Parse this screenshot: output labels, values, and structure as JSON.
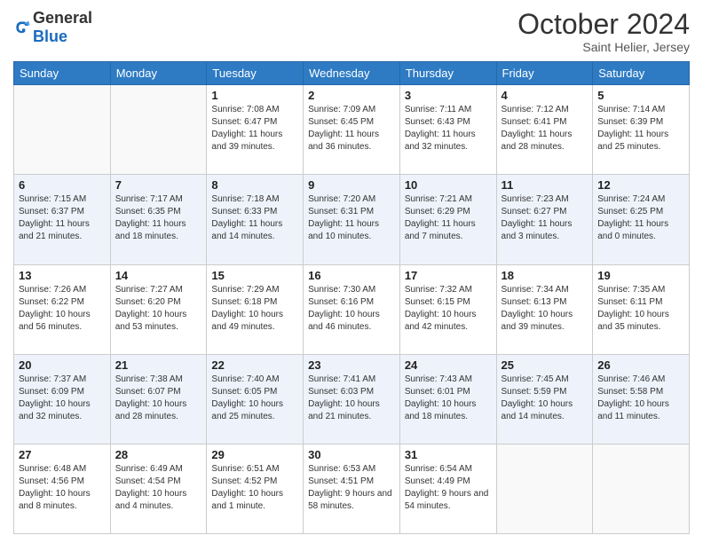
{
  "header": {
    "logo_general": "General",
    "logo_blue": "Blue",
    "month_title": "October 2024",
    "subtitle": "Saint Helier, Jersey"
  },
  "days_of_week": [
    "Sunday",
    "Monday",
    "Tuesday",
    "Wednesday",
    "Thursday",
    "Friday",
    "Saturday"
  ],
  "weeks": [
    [
      {
        "day": "",
        "info": ""
      },
      {
        "day": "",
        "info": ""
      },
      {
        "day": "1",
        "info": "Sunrise: 7:08 AM\nSunset: 6:47 PM\nDaylight: 11 hours and 39 minutes."
      },
      {
        "day": "2",
        "info": "Sunrise: 7:09 AM\nSunset: 6:45 PM\nDaylight: 11 hours and 36 minutes."
      },
      {
        "day": "3",
        "info": "Sunrise: 7:11 AM\nSunset: 6:43 PM\nDaylight: 11 hours and 32 minutes."
      },
      {
        "day": "4",
        "info": "Sunrise: 7:12 AM\nSunset: 6:41 PM\nDaylight: 11 hours and 28 minutes."
      },
      {
        "day": "5",
        "info": "Sunrise: 7:14 AM\nSunset: 6:39 PM\nDaylight: 11 hours and 25 minutes."
      }
    ],
    [
      {
        "day": "6",
        "info": "Sunrise: 7:15 AM\nSunset: 6:37 PM\nDaylight: 11 hours and 21 minutes."
      },
      {
        "day": "7",
        "info": "Sunrise: 7:17 AM\nSunset: 6:35 PM\nDaylight: 11 hours and 18 minutes."
      },
      {
        "day": "8",
        "info": "Sunrise: 7:18 AM\nSunset: 6:33 PM\nDaylight: 11 hours and 14 minutes."
      },
      {
        "day": "9",
        "info": "Sunrise: 7:20 AM\nSunset: 6:31 PM\nDaylight: 11 hours and 10 minutes."
      },
      {
        "day": "10",
        "info": "Sunrise: 7:21 AM\nSunset: 6:29 PM\nDaylight: 11 hours and 7 minutes."
      },
      {
        "day": "11",
        "info": "Sunrise: 7:23 AM\nSunset: 6:27 PM\nDaylight: 11 hours and 3 minutes."
      },
      {
        "day": "12",
        "info": "Sunrise: 7:24 AM\nSunset: 6:25 PM\nDaylight: 11 hours and 0 minutes."
      }
    ],
    [
      {
        "day": "13",
        "info": "Sunrise: 7:26 AM\nSunset: 6:22 PM\nDaylight: 10 hours and 56 minutes."
      },
      {
        "day": "14",
        "info": "Sunrise: 7:27 AM\nSunset: 6:20 PM\nDaylight: 10 hours and 53 minutes."
      },
      {
        "day": "15",
        "info": "Sunrise: 7:29 AM\nSunset: 6:18 PM\nDaylight: 10 hours and 49 minutes."
      },
      {
        "day": "16",
        "info": "Sunrise: 7:30 AM\nSunset: 6:16 PM\nDaylight: 10 hours and 46 minutes."
      },
      {
        "day": "17",
        "info": "Sunrise: 7:32 AM\nSunset: 6:15 PM\nDaylight: 10 hours and 42 minutes."
      },
      {
        "day": "18",
        "info": "Sunrise: 7:34 AM\nSunset: 6:13 PM\nDaylight: 10 hours and 39 minutes."
      },
      {
        "day": "19",
        "info": "Sunrise: 7:35 AM\nSunset: 6:11 PM\nDaylight: 10 hours and 35 minutes."
      }
    ],
    [
      {
        "day": "20",
        "info": "Sunrise: 7:37 AM\nSunset: 6:09 PM\nDaylight: 10 hours and 32 minutes."
      },
      {
        "day": "21",
        "info": "Sunrise: 7:38 AM\nSunset: 6:07 PM\nDaylight: 10 hours and 28 minutes."
      },
      {
        "day": "22",
        "info": "Sunrise: 7:40 AM\nSunset: 6:05 PM\nDaylight: 10 hours and 25 minutes."
      },
      {
        "day": "23",
        "info": "Sunrise: 7:41 AM\nSunset: 6:03 PM\nDaylight: 10 hours and 21 minutes."
      },
      {
        "day": "24",
        "info": "Sunrise: 7:43 AM\nSunset: 6:01 PM\nDaylight: 10 hours and 18 minutes."
      },
      {
        "day": "25",
        "info": "Sunrise: 7:45 AM\nSunset: 5:59 PM\nDaylight: 10 hours and 14 minutes."
      },
      {
        "day": "26",
        "info": "Sunrise: 7:46 AM\nSunset: 5:58 PM\nDaylight: 10 hours and 11 minutes."
      }
    ],
    [
      {
        "day": "27",
        "info": "Sunrise: 6:48 AM\nSunset: 4:56 PM\nDaylight: 10 hours and 8 minutes."
      },
      {
        "day": "28",
        "info": "Sunrise: 6:49 AM\nSunset: 4:54 PM\nDaylight: 10 hours and 4 minutes."
      },
      {
        "day": "29",
        "info": "Sunrise: 6:51 AM\nSunset: 4:52 PM\nDaylight: 10 hours and 1 minute."
      },
      {
        "day": "30",
        "info": "Sunrise: 6:53 AM\nSunset: 4:51 PM\nDaylight: 9 hours and 58 minutes."
      },
      {
        "day": "31",
        "info": "Sunrise: 6:54 AM\nSunset: 4:49 PM\nDaylight: 9 hours and 54 minutes."
      },
      {
        "day": "",
        "info": ""
      },
      {
        "day": "",
        "info": ""
      }
    ]
  ]
}
